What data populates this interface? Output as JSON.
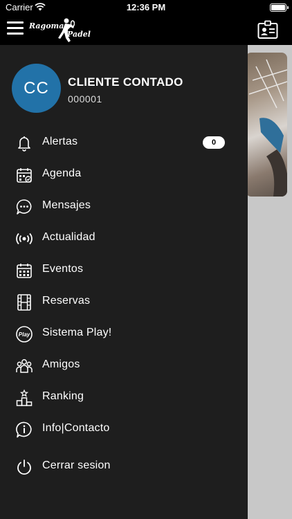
{
  "status_bar": {
    "carrier": "Carrier",
    "time": "12:36 PM"
  },
  "header": {
    "logo_line1": "Ragoma",
    "logo_line2": "Padel"
  },
  "user": {
    "initials": "CC",
    "name": "CLIENTE CONTADO",
    "id": "000001"
  },
  "menu": [
    {
      "label": "Alertas",
      "icon": "bell-icon",
      "badge": "0"
    },
    {
      "label": "Agenda",
      "icon": "calendar-check-icon"
    },
    {
      "label": "Mensajes",
      "icon": "chat-bubble-icon"
    },
    {
      "label": "Actualidad",
      "icon": "broadcast-icon"
    },
    {
      "label": "Eventos",
      "icon": "calendar-grid-icon"
    },
    {
      "label": "Reservas",
      "icon": "film-strip-icon"
    },
    {
      "label": "Sistema Play!",
      "icon": "play-logo-icon"
    },
    {
      "label": "Amigos",
      "icon": "group-icon"
    },
    {
      "label": "Ranking",
      "icon": "podium-icon"
    },
    {
      "label": "Info|Contacto",
      "icon": "info-icon"
    },
    {
      "label": "Cerrar sesion",
      "icon": "power-icon"
    }
  ],
  "colors": {
    "avatar": "#2272a8",
    "drawer_bg": "#1e1e1e",
    "header_bg": "#000000"
  }
}
